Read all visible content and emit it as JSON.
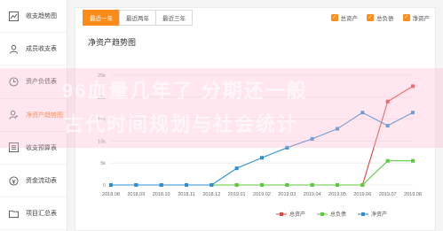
{
  "sidebar": {
    "items": [
      {
        "label": "收支趋势图",
        "icon": "trend-icon",
        "active": false
      },
      {
        "label": "成员收支表",
        "icon": "user-icon",
        "active": false
      },
      {
        "label": "资产负债表",
        "icon": "clock-icon",
        "active": false
      },
      {
        "label": "净资产趋势图",
        "icon": "user-chart-icon",
        "active": true
      },
      {
        "label": "收支预算表",
        "icon": "budget-icon",
        "active": false
      },
      {
        "label": "资金流动表",
        "icon": "cashflow-icon",
        "active": false
      },
      {
        "label": "项目汇总表",
        "icon": "folder-icon",
        "active": false
      }
    ]
  },
  "tabs": [
    {
      "label": "最近一年",
      "active": true
    },
    {
      "label": "最近两年",
      "active": false
    },
    {
      "label": "最近三年",
      "active": false
    }
  ],
  "filters": [
    {
      "label": "总资产",
      "checked": true
    },
    {
      "label": "总负债",
      "checked": true
    },
    {
      "label": "净资产",
      "checked": true
    }
  ],
  "watermark": {
    "line1": "96血量几年了 分期还一般",
    "line2": "古代时间规划与社会统计"
  },
  "colors": {
    "accent": "#ff8c1a",
    "total_assets": "#e8413c",
    "total_liabilities": "#5cc93a",
    "net_assets": "#2b8fd6"
  },
  "chart_data": {
    "type": "line",
    "title": "净资产趋势图",
    "categories": [
      "2018.08",
      "2018.09",
      "2018.10",
      "2018.11",
      "2018.12",
      "2019.01",
      "2019.02",
      "2019.03",
      "2019.04",
      "2019.05",
      "2019.06",
      "2019.07",
      "2019.08"
    ],
    "ylim": [
      0,
      25000
    ],
    "yticks": [
      "0",
      "5k",
      "10k",
      "15k",
      "20k",
      "25k"
    ],
    "grid": true,
    "legend_position": "bottom",
    "series": [
      {
        "name": "总资产",
        "color": "#e8413c",
        "values": [
          0,
          0,
          0,
          0,
          0,
          0,
          0,
          0,
          0,
          0,
          0,
          19000,
          22500
        ]
      },
      {
        "name": "总负债",
        "color": "#5cc93a",
        "values": [
          0,
          0,
          0,
          0,
          0,
          0,
          0,
          0,
          0,
          0,
          0,
          5500,
          5500
        ]
      },
      {
        "name": "净资产",
        "color": "#2b8fd6",
        "values": [
          0,
          0,
          0,
          0,
          0,
          3800,
          6200,
          8500,
          10500,
          12800,
          16500,
          13500,
          16500
        ]
      }
    ]
  }
}
